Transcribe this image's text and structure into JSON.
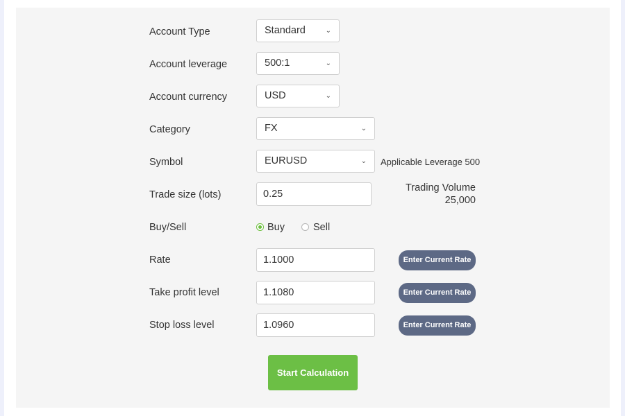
{
  "form": {
    "account_type": {
      "label": "Account Type",
      "value": "Standard"
    },
    "account_leverage": {
      "label": "Account leverage",
      "value": "500:1"
    },
    "account_currency": {
      "label": "Account currency",
      "value": "USD"
    },
    "category": {
      "label": "Category",
      "value": "FX"
    },
    "symbol": {
      "label": "Symbol",
      "value": "EURUSD",
      "note": "Applicable Leverage 500"
    },
    "trade_size": {
      "label": "Trade size  (lots)",
      "value": "0.25",
      "volume_label": "Trading Volume",
      "volume_value": "25,000"
    },
    "buy_sell": {
      "label": "Buy/Sell",
      "options": [
        "Buy",
        "Sell"
      ],
      "selected": "Buy"
    },
    "rate": {
      "label": "Rate",
      "value": "1.1000"
    },
    "take_profit": {
      "label": "Take profit level",
      "value": "1.1080"
    },
    "stop_loss": {
      "label": "Stop loss level",
      "value": "1.0960"
    },
    "enter_rate_label": "Enter Current Rate",
    "start_label": "Start Calculation"
  },
  "icons": {
    "dropdown": "chevron-down-icon"
  },
  "colors": {
    "accent_green": "#6cbf45",
    "rate_button": "#5d6985",
    "panel_bg": "#f5f5f5"
  }
}
